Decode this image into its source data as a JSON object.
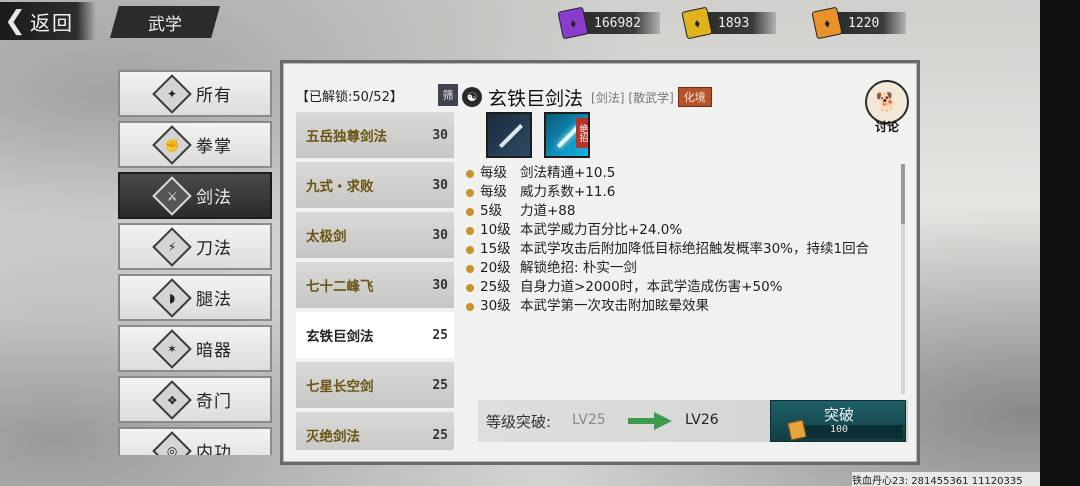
{
  "header": {
    "back_arrow": "❮",
    "back_label": "返回",
    "section_title": "武学"
  },
  "currencies": [
    {
      "icon": "purple-ticket-icon",
      "color": "#8a3ccf",
      "value": "166982"
    },
    {
      "icon": "gold-ticket-icon",
      "color": "#e0b31e",
      "value": "1893"
    },
    {
      "icon": "orange-ticket-icon",
      "color": "#e9922b",
      "value": "1220"
    }
  ],
  "categories": [
    {
      "label": "所有",
      "icon": "all-icon",
      "glyph": "✦",
      "active": false
    },
    {
      "label": "拳掌",
      "icon": "fist-icon",
      "glyph": "✊",
      "active": false
    },
    {
      "label": "剑法",
      "icon": "sword-icon",
      "glyph": "⚔",
      "active": true
    },
    {
      "label": "刀法",
      "icon": "blade-icon",
      "glyph": "⚡",
      "active": false
    },
    {
      "label": "腿法",
      "icon": "kick-icon",
      "glyph": "◗",
      "active": false
    },
    {
      "label": "暗器",
      "icon": "shuriken-icon",
      "glyph": "✶",
      "active": false
    },
    {
      "label": "奇门",
      "icon": "scroll-icon",
      "glyph": "❖",
      "active": false
    },
    {
      "label": "内功",
      "icon": "inner-icon",
      "glyph": "◎",
      "active": false
    }
  ],
  "skill_list": {
    "unlock_text": "【已解锁:50/52】",
    "filter_label": "筛",
    "items": [
      {
        "name": "五岳独尊剑法",
        "level": "30",
        "selected": false
      },
      {
        "name": "九式・求败",
        "level": "30",
        "selected": false
      },
      {
        "name": "太极剑",
        "level": "30",
        "selected": false
      },
      {
        "name": "七十二峰飞",
        "level": "30",
        "selected": false
      },
      {
        "name": "玄铁巨剑法",
        "level": "25",
        "selected": true
      },
      {
        "name": "七星长空剑",
        "level": "25",
        "selected": false
      },
      {
        "name": "灭绝剑法",
        "level": "25",
        "selected": false
      }
    ]
  },
  "detail": {
    "title": "玄铁巨剑法",
    "tag_type": "[剑法]",
    "tag_class": "[散武学]",
    "tag_rank": "化境",
    "ult_tag": "绝招",
    "effects": [
      {
        "lv": "每级",
        "text": "剑法精通+10.5"
      },
      {
        "lv": "每级",
        "text": "威力系数+11.6"
      },
      {
        "lv": "5级",
        "text": "力道+88"
      },
      {
        "lv": "10级",
        "text": "本武学威力百分比+24.0%"
      },
      {
        "lv": "15级",
        "text": "本武学攻击后附加降低目标绝招触发概率30%，持续1回合"
      },
      {
        "lv": "20级",
        "text": "解锁绝招:  朴实一剑"
      },
      {
        "lv": "25级",
        "text": "自身力道>2000时，本武学造成伤害+50%"
      },
      {
        "lv": "30级",
        "text": "本武学第一次攻击附加眩晕效果"
      }
    ]
  },
  "discuss": {
    "label": "讨论"
  },
  "breakthrough": {
    "label": "等级突破:",
    "from": "LV25",
    "to": "LV26",
    "button_label": "突破",
    "cost": "100"
  },
  "watermark": "铁血丹心23: 281455361  11120335"
}
